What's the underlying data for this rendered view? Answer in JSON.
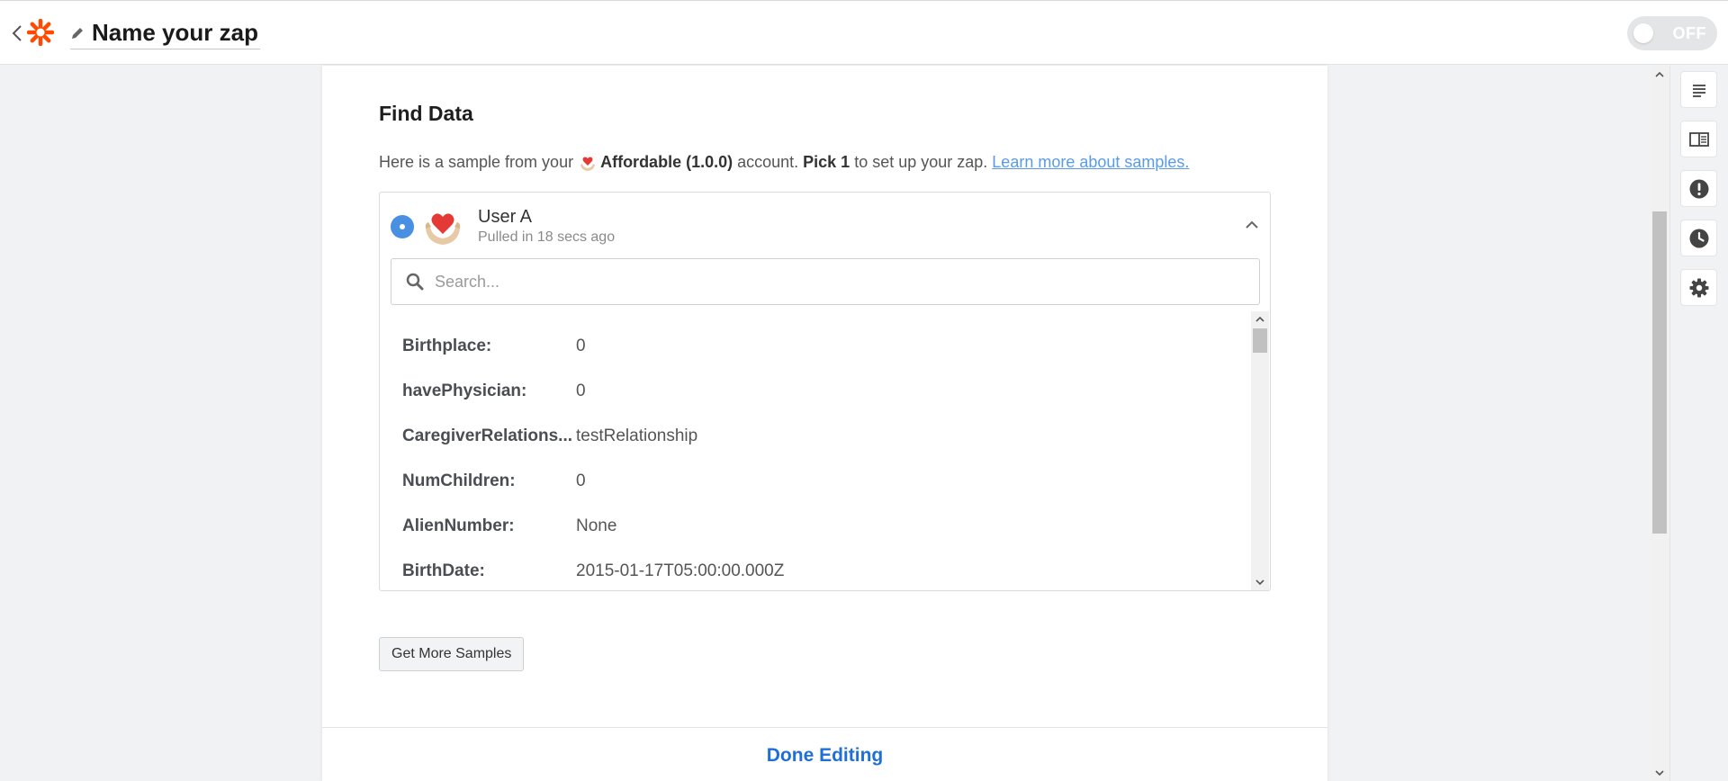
{
  "header": {
    "zap_name": "Name your zap",
    "toggle_label": "OFF"
  },
  "find_data": {
    "title": "Find Data",
    "desc_prefix": "Here is a sample from your",
    "app_name": "Affordable (1.0.0)",
    "desc_account": "account.",
    "pick_label": "Pick 1",
    "desc_suffix": "to set up your zap.",
    "learn_more": "Learn more about samples."
  },
  "sample": {
    "name": "User A",
    "pulled": "Pulled in 18 secs ago",
    "search_placeholder": "Search...",
    "fields": [
      {
        "key": "Birthplace:",
        "value": "0"
      },
      {
        "key": "havePhysician:",
        "value": "0"
      },
      {
        "key": "CaregiverRelations...",
        "value": "testRelationship"
      },
      {
        "key": "NumChildren:",
        "value": "0"
      },
      {
        "key": "AlienNumber:",
        "value": "None"
      },
      {
        "key": "BirthDate:",
        "value": "2015-01-17T05:00:00.000Z"
      }
    ]
  },
  "buttons": {
    "get_more": "Get More Samples",
    "done": "Done Editing"
  },
  "icons": {
    "back": "chevron-left-icon",
    "logo": "zapier-logo-icon",
    "edit": "pencil-icon",
    "search": "search-icon",
    "collapse": "chevron-up-icon",
    "sidebar": [
      "details-icon",
      "guide-icon",
      "alert-icon",
      "history-icon",
      "settings-icon"
    ]
  },
  "colors": {
    "brand": "#ff4a00",
    "link": "#5a9be8",
    "radio": "#4a90e2",
    "done": "#1f6fd8",
    "heart": "#e53935"
  }
}
